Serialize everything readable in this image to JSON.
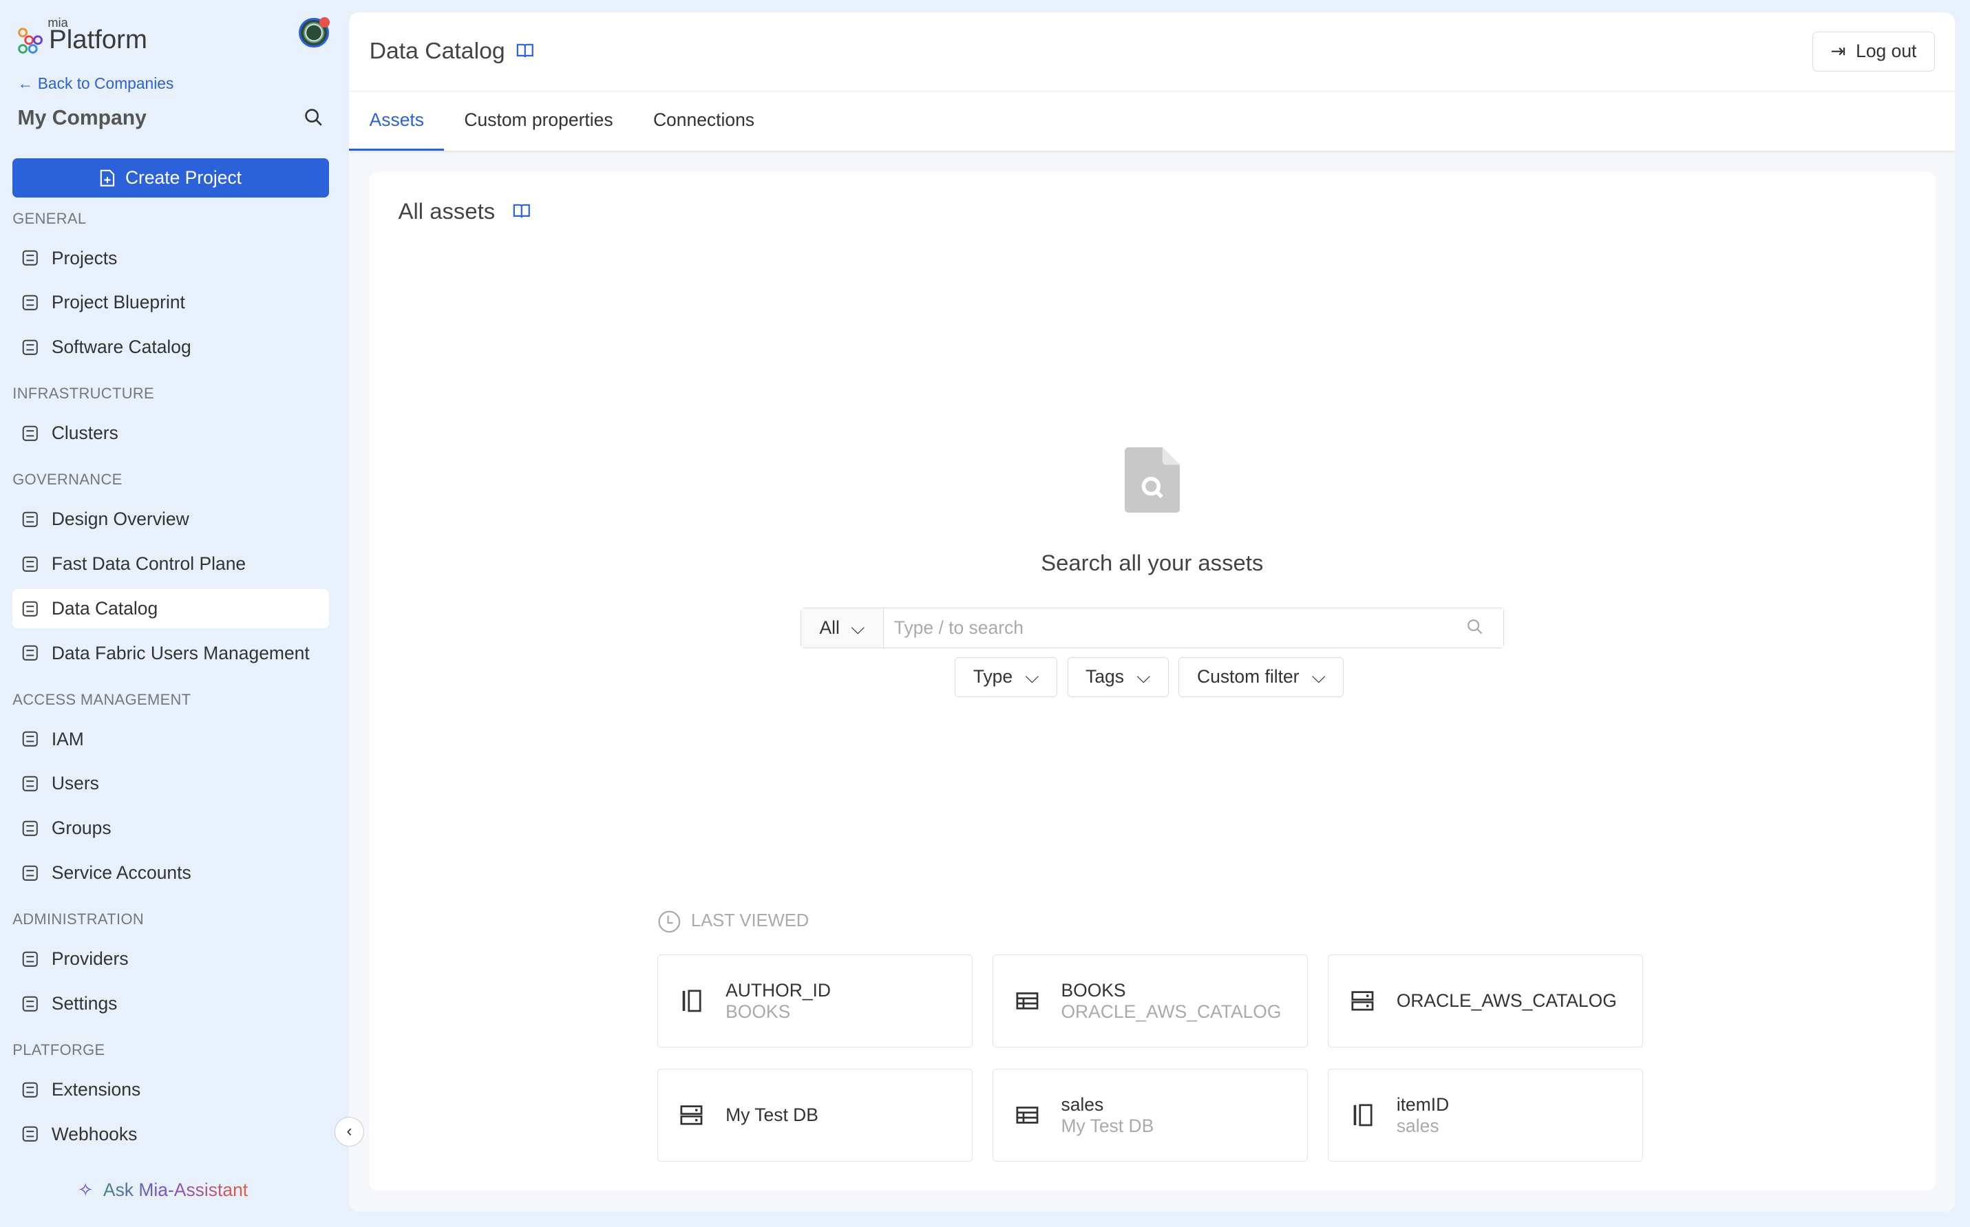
{
  "brand": {
    "small": "mia",
    "name": "Platform"
  },
  "sidebar": {
    "back": "Back to Companies",
    "company": "My Company",
    "create": "Create Project",
    "sections": [
      {
        "title": "GENERAL",
        "items": [
          {
            "label": "Projects",
            "icon": "project-icon"
          },
          {
            "label": "Project Blueprint",
            "icon": "blueprint-icon"
          },
          {
            "label": "Software Catalog",
            "icon": "cart-icon"
          }
        ]
      },
      {
        "title": "INFRASTRUCTURE",
        "items": [
          {
            "label": "Clusters",
            "icon": "server-icon"
          }
        ]
      },
      {
        "title": "GOVERNANCE",
        "items": [
          {
            "label": "Design Overview",
            "icon": "presentation-icon"
          },
          {
            "label": "Fast Data Control Plane",
            "icon": "globe-icon"
          },
          {
            "label": "Data Catalog",
            "icon": "globe-icon",
            "active": true
          },
          {
            "label": "Data Fabric Users Management",
            "icon": "globe-icon"
          }
        ]
      },
      {
        "title": "ACCESS MANAGEMENT",
        "items": [
          {
            "label": "IAM",
            "icon": "iam-icon"
          },
          {
            "label": "Users",
            "icon": "user-icon"
          },
          {
            "label": "Groups",
            "icon": "groups-icon"
          },
          {
            "label": "Service Accounts",
            "icon": "service-account-icon"
          }
        ]
      },
      {
        "title": "ADMINISTRATION",
        "items": [
          {
            "label": "Providers",
            "icon": "cloud-icon"
          },
          {
            "label": "Settings",
            "icon": "gear-icon"
          }
        ]
      },
      {
        "title": "PLATFORGE",
        "items": [
          {
            "label": "Extensions",
            "icon": "extensions-icon"
          },
          {
            "label": "Webhooks",
            "icon": "webhook-icon"
          }
        ]
      }
    ],
    "ask": "Ask Mia-Assistant"
  },
  "header": {
    "title": "Data Catalog",
    "logout": "Log out"
  },
  "tabs": [
    {
      "label": "Assets",
      "active": true
    },
    {
      "label": "Custom properties"
    },
    {
      "label": "Connections"
    }
  ],
  "content": {
    "title": "All assets",
    "empty": "Search all your assets",
    "search": {
      "scope": "All",
      "placeholder": "Type / to search"
    },
    "filters": [
      "Type",
      "Tags",
      "Custom filter"
    ],
    "last_viewed": "LAST VIEWED",
    "assets": [
      {
        "name": "AUTHOR_ID",
        "sub": "BOOKS",
        "icon": "column-icon"
      },
      {
        "name": "BOOKS",
        "sub": "ORACLE_AWS_CATALOG",
        "icon": "table-icon"
      },
      {
        "name": "ORACLE_AWS_CATALOG",
        "sub": "",
        "icon": "database-icon"
      },
      {
        "name": "My Test DB",
        "sub": "",
        "icon": "database-icon"
      },
      {
        "name": "sales",
        "sub": "My Test DB",
        "icon": "table-icon"
      },
      {
        "name": "itemID",
        "sub": "sales",
        "icon": "column-icon"
      }
    ]
  },
  "colors": {
    "accent": "#2b62d9",
    "sidebar_bg": "#e8f0fb"
  }
}
